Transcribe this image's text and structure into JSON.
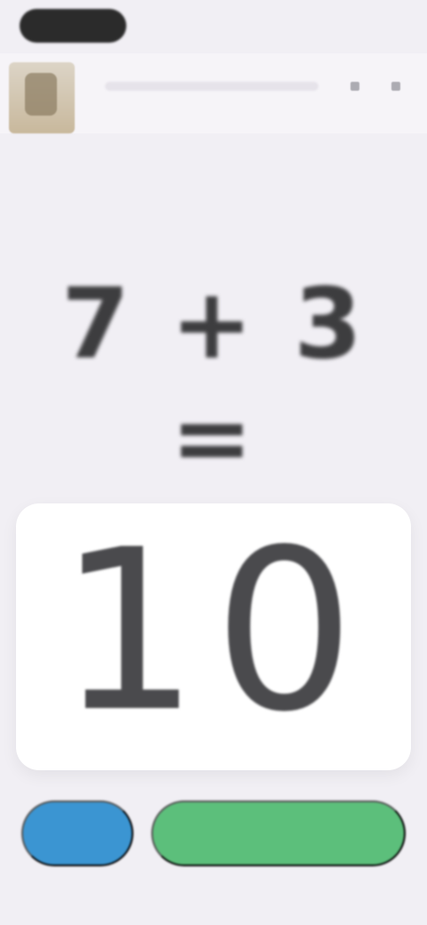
{
  "header": {
    "title": "",
    "icons": [
      "settings-icon",
      "menu-icon"
    ]
  },
  "question": {
    "expression": "7 + 3 ="
  },
  "answer": {
    "value": "10"
  },
  "buttons": {
    "left_label": "",
    "right_label": ""
  },
  "colors": {
    "background": "#f1eff4",
    "answer_card": "#ffffff",
    "left_button": "#3b95d2",
    "right_button": "#5cbf7b",
    "text": "#3d3d3f"
  }
}
